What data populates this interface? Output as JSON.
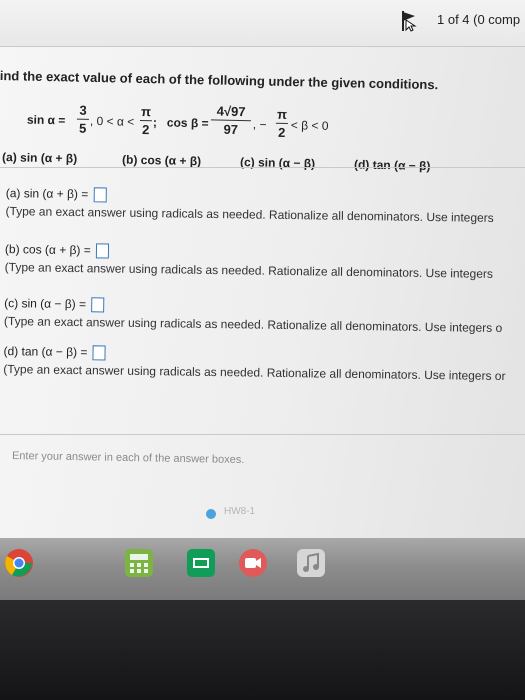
{
  "header": {
    "pager_text": "1 of 4 (0 comp"
  },
  "problem": {
    "instruction": "ind the exact value of each of the following under the given conditions.",
    "sin_alpha": {
      "lhs": "sin α =",
      "num": "3",
      "den": "5",
      "after": ", 0 < α <",
      "range_num": "π",
      "range_den": "2",
      "end": ";"
    },
    "cos_beta": {
      "lhs": "cos β =",
      "num": "4√97",
      "den": "97",
      "after": ",  −",
      "range_num": "π",
      "range_den": "2",
      "end": "< β < 0"
    },
    "items": [
      {
        "label": "(a)  sin (α + β)"
      },
      {
        "label": "(b)  cos (α + β)"
      },
      {
        "label": "(c)  sin (α − β)"
      },
      {
        "label": "(d)  tan (α − β)"
      }
    ]
  },
  "answers": [
    {
      "label": "(a)  sin (α + β) =",
      "hint": "(Type an exact answer using radicals as needed. Rationalize all denominators. Use integers"
    },
    {
      "label": "(b)  cos (α + β) =",
      "hint": "(Type an exact answer using radicals as needed. Rationalize all denominators. Use integers"
    },
    {
      "label": "(c)  sin (α − β) =",
      "hint": "(Type an exact answer using radicals as needed. Rationalize all denominators. Use integers o"
    },
    {
      "label": "(d)  tan (α − β) =",
      "hint": "(Type an exact answer using radicals as needed. Rationalize all denominators. Use integers or"
    }
  ],
  "footer": {
    "enter_hint": "Enter your answer in each of the answer boxes.",
    "status_text": "HW8-1"
  },
  "colors": {
    "answer_box_border": "#3a78b8",
    "status_dot": "#4aa3df"
  },
  "taskbar_icons": [
    "chrome-icon",
    "calculator-icon",
    "presentation-icon",
    "video-call-icon",
    "music-icon"
  ]
}
